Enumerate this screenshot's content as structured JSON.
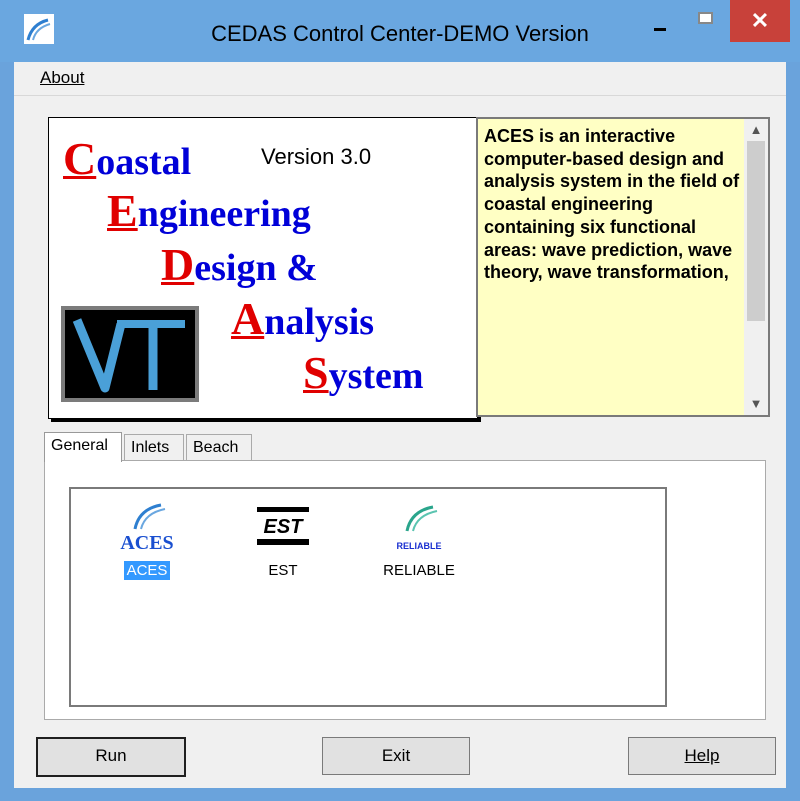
{
  "window": {
    "title": "CEDAS Control Center-DEMO Version",
    "controls": {
      "minimize": "minimize",
      "maximize": "maximize",
      "close": "✕"
    }
  },
  "menu": {
    "about": "About"
  },
  "logo": {
    "lines": [
      {
        "cap": "C",
        "rest": "oastal"
      },
      {
        "cap": "E",
        "rest": "ngineering"
      },
      {
        "cap": "D",
        "rest": "esign &"
      },
      {
        "cap": "A",
        "rest": "nalysis"
      },
      {
        "cap": "S",
        "rest": "ystem"
      }
    ],
    "version": "Version 3.0"
  },
  "description": {
    "text": "ACES is an interactive computer-based design and analysis system in the field of coastal engineering containing six functional areas: wave prediction, wave theory, wave transformation,"
  },
  "tabs": [
    {
      "label": "General",
      "active": true
    },
    {
      "label": "Inlets",
      "active": false
    },
    {
      "label": "Beach",
      "active": false
    }
  ],
  "programs": [
    {
      "label": "ACES",
      "icon": "aces-icon",
      "icon_text": "ACES",
      "selected": true
    },
    {
      "label": "EST",
      "icon": "est-icon",
      "icon_text": "EST",
      "selected": false
    },
    {
      "label": "RELIABLE",
      "icon": "reliable-icon",
      "icon_text": "RELIABLE",
      "selected": false
    }
  ],
  "buttons": {
    "run": "Run",
    "exit": "Exit",
    "help": "Help"
  },
  "colors": {
    "selection": "#3399ff",
    "desc_bg": "#ffffc4",
    "logo_blue": "#0000d8",
    "logo_red": "#e00000",
    "close": "#c8413a"
  }
}
